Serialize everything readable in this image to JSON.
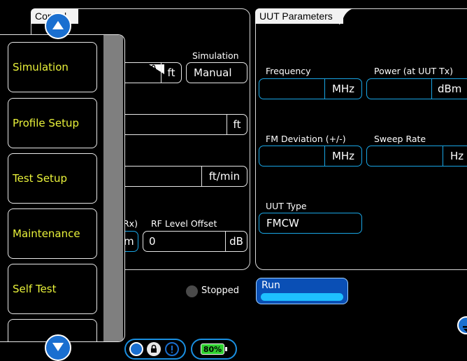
{
  "control": {
    "tab_label": "Control"
  },
  "uut": {
    "tab_label": "UUT Parameters",
    "frequency": {
      "label": "Frequency",
      "value": "",
      "unit": "MHz"
    },
    "power": {
      "label": "Power (at UUT Tx)",
      "value": "",
      "unit": "dBm"
    },
    "fm_deviation": {
      "label": "FM Deviation (+/-)",
      "value": "",
      "unit": "MHz"
    },
    "sweep_rate": {
      "label": "Sweep Rate",
      "value": "",
      "unit": "Hz"
    },
    "uut_type": {
      "label": "UUT Type",
      "value": "FMCW"
    }
  },
  "control_fields": {
    "simulation": {
      "label": "Simulation",
      "value": "Manual"
    },
    "altitude_unit": "ft",
    "field2_unit": "ft",
    "rate_unit": "ft/min",
    "rx_label_fragment": "Rx)",
    "rx_unit_fragment": "m",
    "rf_level_offset": {
      "label": "RF Level Offset",
      "value": "0",
      "unit": "dB"
    }
  },
  "status": {
    "text": "Stopped"
  },
  "run_button": {
    "label": "Run"
  },
  "menu": {
    "items": [
      {
        "label": "Simulation"
      },
      {
        "label": "Profile Setup"
      },
      {
        "label": "Test Setup"
      },
      {
        "label": "Maintenance"
      },
      {
        "label": "Self Test"
      },
      {
        "label": ""
      }
    ]
  },
  "battery": {
    "percent_label": "80%"
  },
  "colors": {
    "accent_blue": "#19a6e6",
    "menu_text": "#e9f23a",
    "battery_green": "#2fd12f"
  }
}
